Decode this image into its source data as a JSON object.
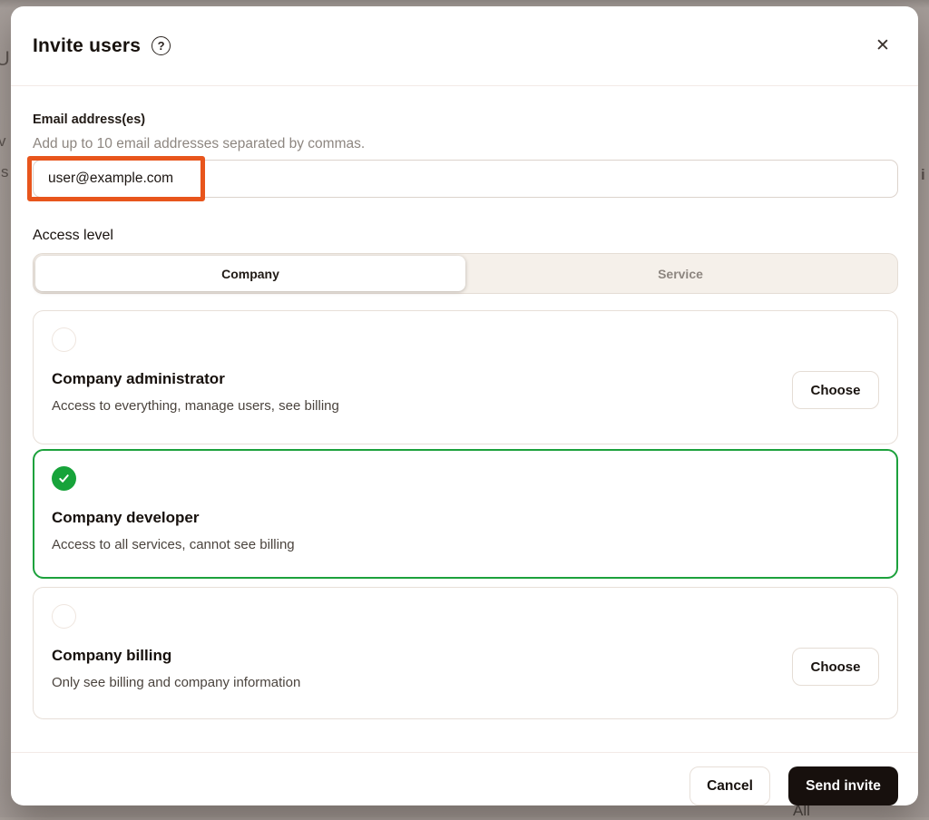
{
  "modal": {
    "title": "Invite users",
    "help_icon_glyph": "?",
    "close_icon_glyph": "✕",
    "email": {
      "label": "Email address(es)",
      "helper": "Add up to 10 email addresses separated by commas.",
      "value": "user@example.com"
    },
    "access_level": {
      "label": "Access level",
      "tabs": [
        {
          "label": "Company",
          "selected": true
        },
        {
          "label": "Service",
          "selected": false
        }
      ]
    },
    "options": [
      {
        "title": "Company administrator",
        "description": "Access to everything, manage users, see billing",
        "selected": false,
        "action_label": "Choose"
      },
      {
        "title": "Company developer",
        "description": "Access to all services, cannot see billing",
        "selected": true
      },
      {
        "title": "Company billing",
        "description": "Only see billing and company information",
        "selected": false,
        "action_label": "Choose"
      }
    ],
    "footer": {
      "cancel_label": "Cancel",
      "submit_label": "Send invite"
    }
  },
  "backdrop_fragments": {
    "left_1": "U",
    "left_2": "v",
    "left_3": "s",
    "right_1": "i",
    "bottom_1": "All"
  },
  "colors": {
    "accent_green": "#17a33a",
    "selected_border": "#1ca13c",
    "annotation_orange": "#e8551c",
    "primary_button_bg": "#17100d",
    "backdrop": "#a9a19c"
  }
}
